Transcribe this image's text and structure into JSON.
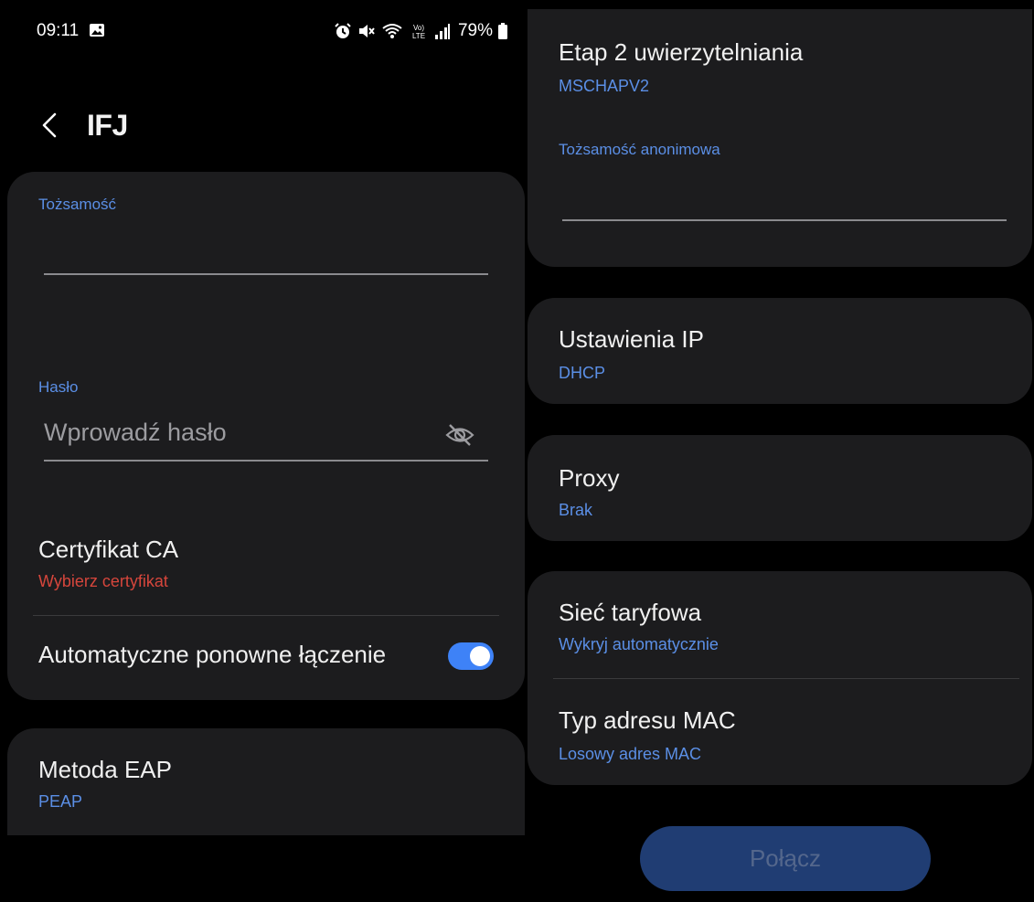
{
  "status_bar": {
    "time": "09:11",
    "battery": "79%",
    "icons": [
      "gallery-icon",
      "alarm-icon",
      "mute-icon",
      "wifi-calling-icon",
      "volte-icon",
      "signal-icon",
      "battery-icon"
    ]
  },
  "header": {
    "title": "IFJ",
    "back_icon": "chevron-left-icon"
  },
  "left_card": {
    "identity_label": "Tożsamość",
    "identity_value": "",
    "password_label": "Hasło",
    "password_placeholder": "Wprowadź hasło",
    "password_visibility_icon": "eye-off-icon",
    "ca_cert_title": "Certyfikat CA",
    "ca_cert_value": "Wybierz certyfikat",
    "auto_reconnect_label": "Automatyczne ponowne łączenie",
    "auto_reconnect_on": true
  },
  "eap_card": {
    "title": "Metoda EAP",
    "value": "PEAP"
  },
  "phase2_card": {
    "title": "Etap 2 uwierzytelniania",
    "value": "MSCHAPV2",
    "anon_label": "Tożsamość anonimowa",
    "anon_value": ""
  },
  "ip_card": {
    "title": "Ustawienia IP",
    "value": "DHCP"
  },
  "proxy_card": {
    "title": "Proxy",
    "value": "Brak"
  },
  "metered_card": {
    "metered_title": "Sieć taryfowa",
    "metered_value": "Wykryj automatycznie",
    "mac_title": "Typ adresu MAC",
    "mac_value": "Losowy adres MAC"
  },
  "connect_button": "Połącz",
  "colors": {
    "accent": "#5b8fe6",
    "warning": "#d6463c",
    "toggle_on": "#3e82f7",
    "card_bg": "#1c1c1e",
    "button_disabled_bg": "#203d73"
  }
}
